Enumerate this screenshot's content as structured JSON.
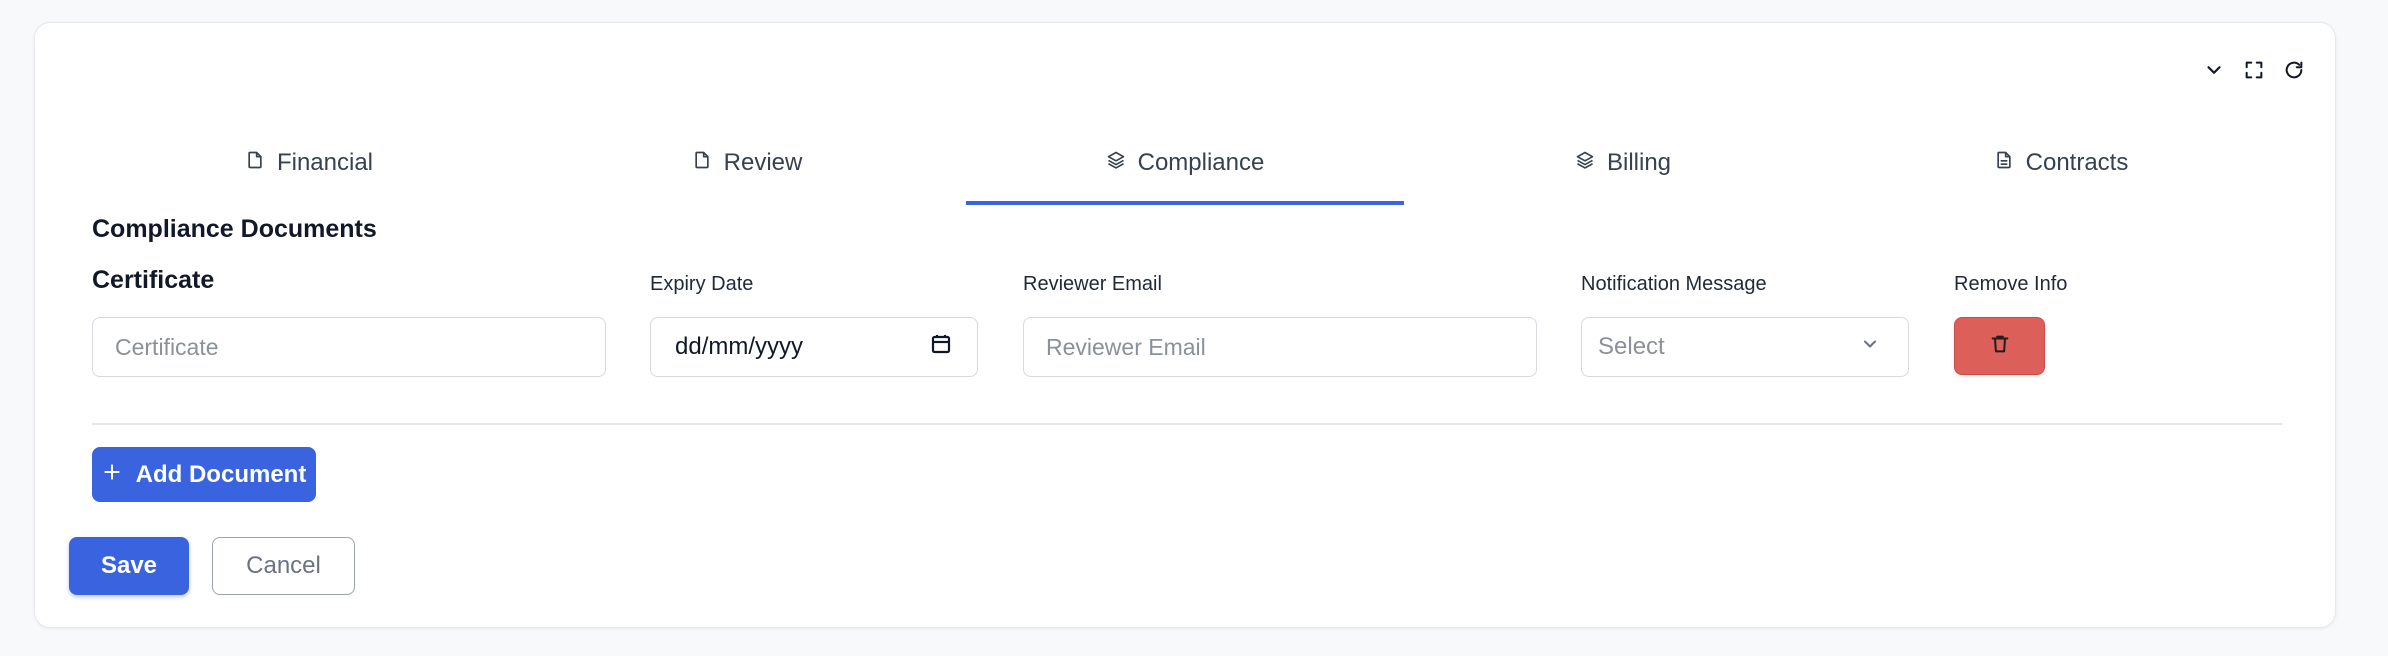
{
  "tabs": [
    {
      "label": "Financial",
      "icon": "file-icon"
    },
    {
      "label": "Review",
      "icon": "file-icon"
    },
    {
      "label": "Compliance",
      "icon": "layers-icon",
      "active": true
    },
    {
      "label": "Billing",
      "icon": "layers-icon"
    },
    {
      "label": "Contracts",
      "icon": "document-icon"
    }
  ],
  "section": {
    "title": "Compliance Documents"
  },
  "fields": {
    "certificate": {
      "label": "Certificate",
      "placeholder": "Certificate",
      "value": ""
    },
    "expiry_date": {
      "label": "Expiry Date",
      "value": "dd/mm/yyyy"
    },
    "reviewer_email": {
      "label": "Reviewer Email",
      "placeholder": "Reviewer Email",
      "value": ""
    },
    "notification_message": {
      "label": "Notification Message",
      "value": "Select"
    },
    "remove_info": {
      "label": "Remove Info"
    }
  },
  "actions": {
    "add_document_label": "Add Document",
    "save_label": "Save",
    "cancel_label": "Cancel"
  },
  "colors": {
    "accent": "#3a63e0",
    "danger": "#dc5f5a",
    "background": "#f8f9fb"
  }
}
